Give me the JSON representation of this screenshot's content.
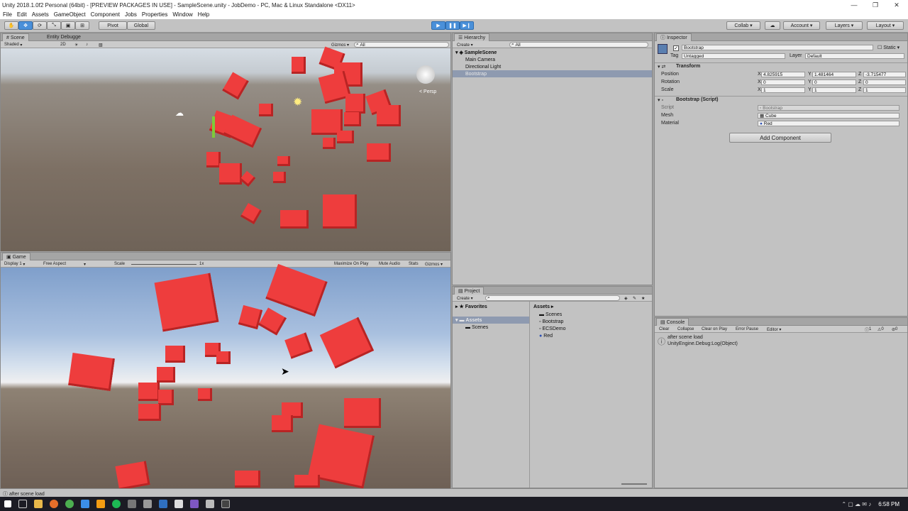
{
  "window": {
    "title": "Unity 2018.1.0f2 Personal (64bit) - [PREVIEW PACKAGES IN USE] - SampleScene.unity - JobDemo - PC, Mac & Linux Standalone <DX11>"
  },
  "menu": [
    "File",
    "Edit",
    "Assets",
    "GameObject",
    "Component",
    "Jobs",
    "Properties",
    "Window",
    "Help"
  ],
  "toolbar": {
    "pivot": "Pivot",
    "global": "Global",
    "collab": "Collab ▾",
    "account": "Account",
    "layers": "Layers",
    "layout": "Layout"
  },
  "scene": {
    "tab": "Scene",
    "tab2": "Entity Debugge",
    "shading": "Shaded",
    "mode2d": "2D",
    "gizmos": "Gizmos ▾",
    "search": "All",
    "persp": "< Persp"
  },
  "game": {
    "tab": "Game",
    "display": "Display 1",
    "aspect": "Free Aspect",
    "scale_label": "Scale",
    "scale_value": "1x",
    "maximize": "Maximize On Play",
    "mute": "Mute Audio",
    "stats": "Stats",
    "gizmos": "Gizmos ▾"
  },
  "hierarchy": {
    "tab": "Hierarchy",
    "create": "Create ▾",
    "search": "All",
    "scene": "SampleScene",
    "items": [
      "Main Camera",
      "Directional Light",
      "Bootstrap"
    ]
  },
  "project": {
    "tab": "Project",
    "create": "Create ▾",
    "favorites": "Favorites",
    "assets_tree": "Assets",
    "scenes_tree": "Scenes",
    "breadcrumb": "Assets ▸",
    "files": [
      "Scenes",
      "Bootstrap",
      "ECSDemo",
      "Red"
    ]
  },
  "inspector": {
    "tab": "Inspector",
    "object_name": "Bootstrap",
    "static": "Static ▾",
    "tag_label": "Tag",
    "tag_value": "Untagged",
    "layer_label": "Layer",
    "layer_value": "Default",
    "transform": {
      "title": "Transform",
      "position_label": "Position",
      "rotation_label": "Rotation",
      "scale_label": "Scale",
      "position": [
        "4.825915",
        "1.481464",
        "-3.715477"
      ],
      "rotation": [
        "0",
        "0",
        "0"
      ],
      "scale": [
        "1",
        "1",
        "1"
      ]
    },
    "script": {
      "title": "Bootstrap (Script)",
      "script_label": "Script",
      "script_value": "Bootstrap",
      "mesh_label": "Mesh",
      "mesh_value": "Cube",
      "material_label": "Material",
      "material_value": "Red"
    },
    "add_component": "Add Component"
  },
  "console": {
    "tab": "Console",
    "clear": "Clear",
    "collapse": "Collapse",
    "clear_on_play": "Clear on Play",
    "error_pause": "Error Pause",
    "editor": "Editor ▾",
    "count_log": "1",
    "count_warn": "0",
    "count_err": "0",
    "message": "after scene load",
    "message2": "UnityEngine.Debug:Log(Object)"
  },
  "status": {
    "message": "after scene load"
  },
  "clock": "6:58 PM"
}
